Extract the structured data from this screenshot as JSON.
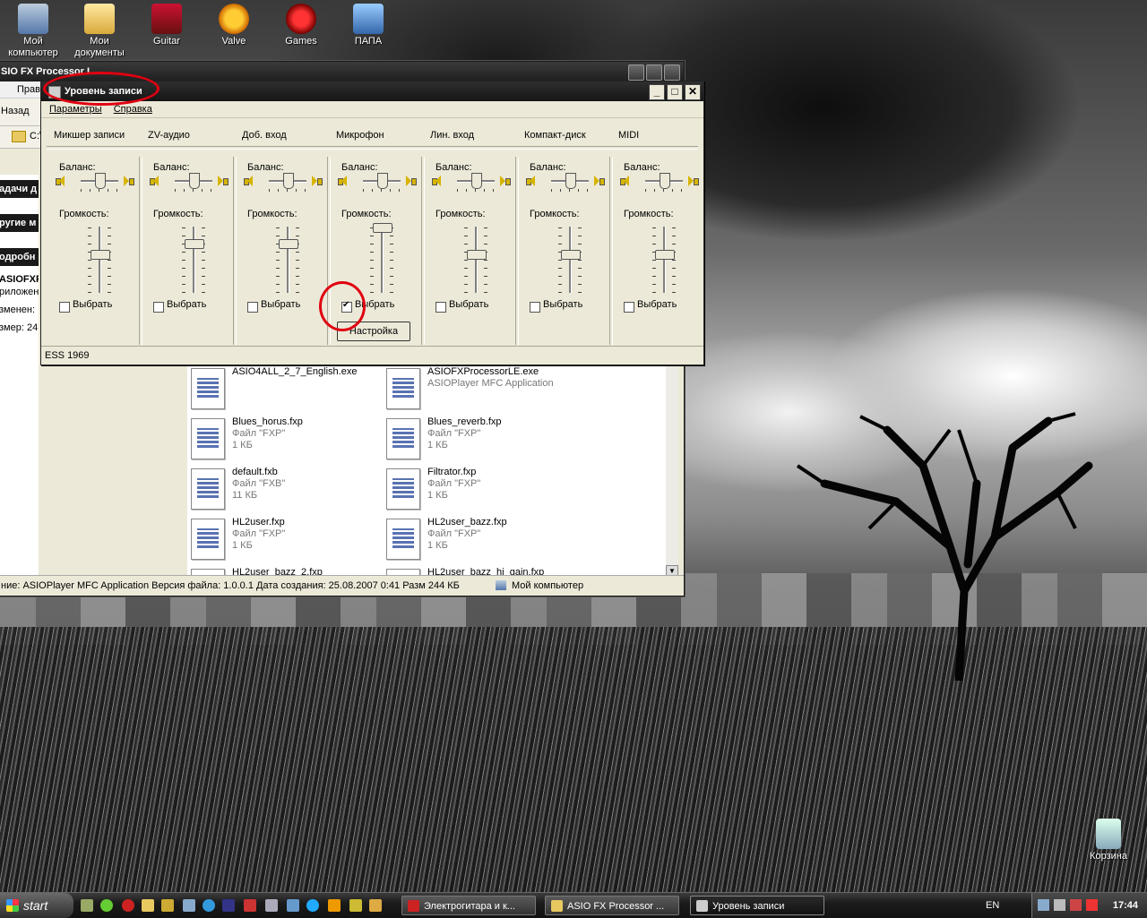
{
  "desktop": {
    "icons": [
      {
        "label": "Мой компьютер",
        "icon": "my-computer-icon"
      },
      {
        "label": "Мои документы",
        "icon": "my-documents-icon"
      },
      {
        "label": "Guitar",
        "icon": "guitar-icon"
      },
      {
        "label": "Valve",
        "icon": "half-life-icon"
      },
      {
        "label": "Games",
        "icon": "games-icon"
      },
      {
        "label": "ПАПА",
        "icon": "folder-papa-icon"
      }
    ],
    "recycle_bin": "Корзина"
  },
  "explorer": {
    "title": "SIO FX Processor L",
    "menu_partial": "Прав",
    "back_label": "Назад",
    "address_partial": "C:\\",
    "left_pane": {
      "tasks_header": "адачи д",
      "other_header": "ругие м",
      "details_header": "одробн",
      "details_name": "ASIOFXP",
      "details_type": "риложен",
      "details_modified": "зменен:",
      "details_size": "змер: 24"
    },
    "files": [
      {
        "name": "ASIO4ALL_2_7_English.exe",
        "sub1": "",
        "sub2": ""
      },
      {
        "name": "ASIOFXProcessorLE.exe",
        "sub1": "ASIOPlayer MFC Application",
        "sub2": ""
      },
      {
        "name": "Blues_horus.fxp",
        "sub1": "Файл \"FXP\"",
        "sub2": "1 КБ"
      },
      {
        "name": "Blues_reverb.fxp",
        "sub1": "Файл \"FXP\"",
        "sub2": "1 КБ"
      },
      {
        "name": "default.fxb",
        "sub1": "Файл \"FXB\"",
        "sub2": "11 КБ"
      },
      {
        "name": "Filtrator.fxp",
        "sub1": "Файл \"FXP\"",
        "sub2": "1 КБ"
      },
      {
        "name": "HL2user.fxp",
        "sub1": "Файл \"FXP\"",
        "sub2": "1 КБ"
      },
      {
        "name": "HL2user_bazz.fxp",
        "sub1": "Файл \"FXP\"",
        "sub2": "1 КБ"
      },
      {
        "name": "HL2user_bazz_2.fxp",
        "sub1": "",
        "sub2": ""
      },
      {
        "name": "HL2user_bazz_hi_gain.fxp",
        "sub1": "",
        "sub2": ""
      }
    ],
    "status_text": "ние: ASIOPlayer MFC Application Версия файла: 1.0.0.1 Дата создания: 25.08.2007 0:41 Разм 244 КБ",
    "status_location": "Мой компьютер"
  },
  "mixer": {
    "title": "Уровень записи",
    "menu": [
      "Параметры",
      "Справка"
    ],
    "columns": [
      "Микшер записи",
      "ZV-аудио",
      "Доб. вход",
      "Микрофон",
      "Лин. вход",
      "Компакт-диск",
      "MIDI"
    ],
    "balance_label": "Баланс:",
    "volume_label": "Громкость:",
    "select_label": "Выбрать",
    "settings_button": "Настройка",
    "status": "ESS 1969",
    "channels": [
      {
        "name": "Микшер записи",
        "balance": 0.5,
        "volume": 0.55,
        "selected": false
      },
      {
        "name": "ZV-аудио",
        "balance": 0.5,
        "volume": 0.72,
        "selected": false
      },
      {
        "name": "Доб. вход",
        "balance": 0.5,
        "volume": 0.72,
        "selected": false
      },
      {
        "name": "Микрофон",
        "balance": 0.5,
        "volume": 1.0,
        "selected": true
      },
      {
        "name": "Лин. вход",
        "balance": 0.5,
        "volume": 0.55,
        "selected": false
      },
      {
        "name": "Компакт-диск",
        "balance": 0.5,
        "volume": 0.55,
        "selected": false
      },
      {
        "name": "MIDI",
        "balance": 0.5,
        "volume": 0.55,
        "selected": false
      }
    ]
  },
  "taskbar": {
    "start_label": "start",
    "tasks": [
      {
        "label": "Электрогитара и к...",
        "icon": "opera-icon",
        "active": false
      },
      {
        "label": "ASIO FX Processor ...",
        "icon": "folder-icon",
        "active": false
      },
      {
        "label": "Уровень записи",
        "icon": "mixer-icon",
        "active": true
      }
    ],
    "language": "EN",
    "clock": "17:44"
  }
}
